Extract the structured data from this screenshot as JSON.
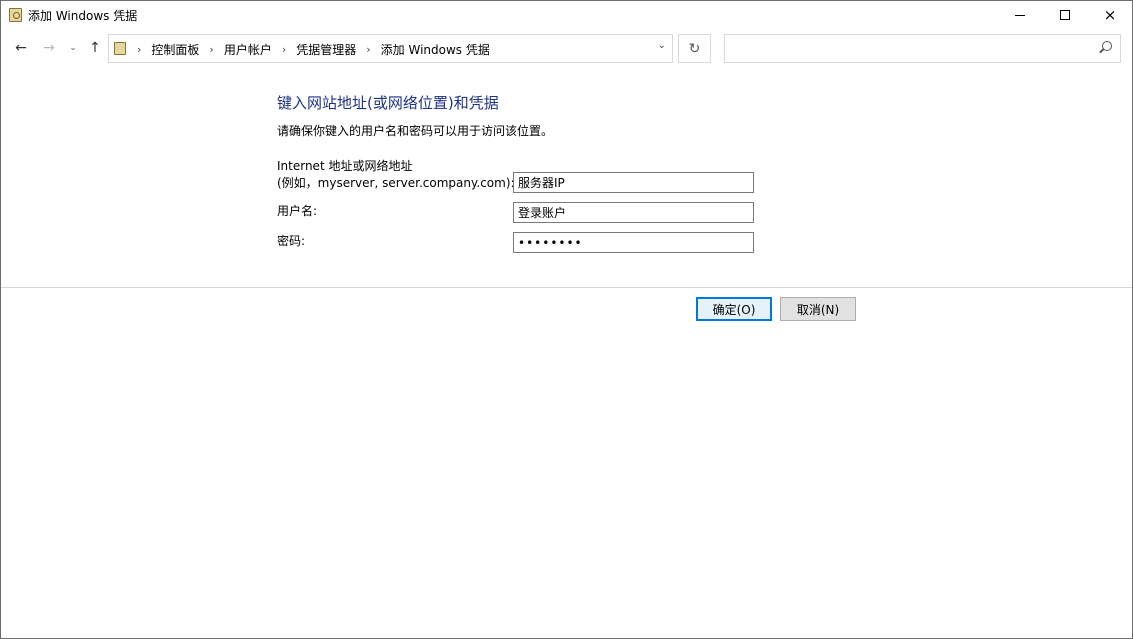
{
  "window": {
    "title": "添加 Windows 凭据",
    "icon": "credential-icon",
    "controls": {
      "minimize": "minimize-icon",
      "maximize": "maximize-icon",
      "close": "×"
    }
  },
  "nav": {
    "back": "←",
    "forward": "→",
    "recent": "⌄",
    "up": "↑",
    "breadcrumbs": [
      "控制面板",
      "用户帐户",
      "凭据管理器",
      "添加 Windows 凭据"
    ],
    "separator": "›",
    "dropdown": "⌄",
    "refresh": "↻",
    "search_placeholder": ""
  },
  "form": {
    "heading": "键入网站地址(或网络位置)和凭据",
    "description": "请确保你键入的用户名和密码可以用于访问该位置。",
    "address_label_line1": "Internet 地址或网络地址",
    "address_label_line2": "(例如，myserver, server.company.com):",
    "address_value": "服务器IP",
    "username_label": "用户名:",
    "username_value": "登录账户",
    "password_label": "密码:",
    "password_value": "••••••••"
  },
  "buttons": {
    "ok": "确定(O)",
    "cancel": "取消(N)"
  },
  "colors": {
    "heading": "#1e3287",
    "focus_border": "#0078d7"
  }
}
